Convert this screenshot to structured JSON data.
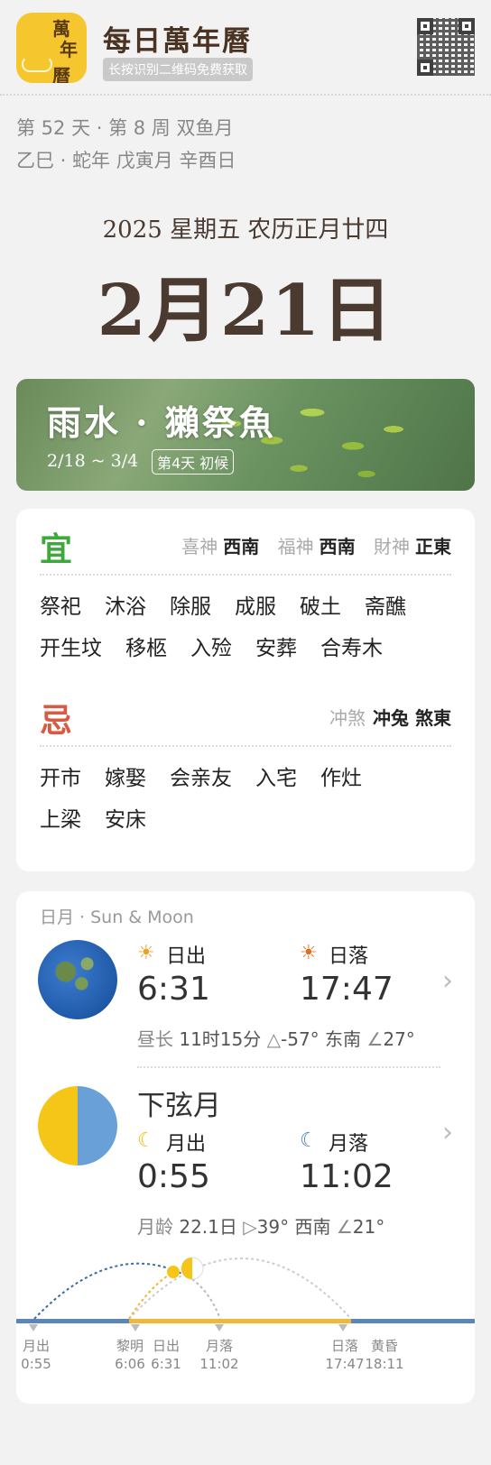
{
  "header": {
    "logo_text": [
      "萬",
      "年",
      "曆"
    ],
    "app_name": "每日萬年曆",
    "subtitle": "长按识别二维码免费获取"
  },
  "info": {
    "line1": "第 52 天 · 第 8 周 双鱼月",
    "line2": "乙巳 · 蛇年 戊寅月 辛酉日"
  },
  "date": {
    "sub": "2025 星期五 农历正月廿四",
    "main": "2月21日"
  },
  "solar_term": {
    "name": "雨水 · 獺祭魚",
    "range": "2/18 ~ 3/4",
    "badge": "第4天 初候"
  },
  "yi": {
    "icon_label": "宜",
    "gods": [
      {
        "k": "喜神",
        "v": "西南"
      },
      {
        "k": "福神",
        "v": "西南"
      },
      {
        "k": "財神",
        "v": "正東"
      }
    ],
    "activities": [
      "祭祀",
      "沐浴",
      "除服",
      "成服",
      "破土",
      "斋醮",
      "开生坟",
      "移柩",
      "入殓",
      "安葬",
      "合寿木"
    ]
  },
  "ji": {
    "icon_label": "忌",
    "chong_k": "冲煞",
    "chong_v": "冲兔 煞東",
    "activities": [
      "开市",
      "嫁娶",
      "会亲友",
      "入宅",
      "作灶",
      "上梁",
      "安床"
    ]
  },
  "sun_moon": {
    "title": "日月 · Sun & Moon",
    "sunrise_label": "日出",
    "sunrise": "6:31",
    "sunset_label": "日落",
    "sunset": "17:47",
    "day_length_k": "昼长",
    "day_length_v": "11时15分",
    "sun_az": "-57° 东南",
    "sun_alt": "27°",
    "moon_phase": "下弦月",
    "moonrise_label": "月出",
    "moonrise": "0:55",
    "moonset_label": "月落",
    "moonset": "11:02",
    "moon_age_k": "月龄",
    "moon_age_v": "22.1日",
    "moon_az": "39° 西南",
    "moon_alt": "21°"
  },
  "timeline": [
    {
      "label": "月出",
      "time": "0:55"
    },
    {
      "label": "黎明",
      "time": "6:06"
    },
    {
      "label": "日出",
      "time": "6:31"
    },
    {
      "label": "月落",
      "time": "11:02"
    },
    {
      "label": "日落",
      "time": "17:47"
    },
    {
      "label": "黄昏",
      "time": "18:11"
    }
  ],
  "colors": {
    "yi": "#3fa83c",
    "ji": "#d95a43",
    "sun_bar": "#f0b838",
    "night_bar": "#5a86b8"
  }
}
